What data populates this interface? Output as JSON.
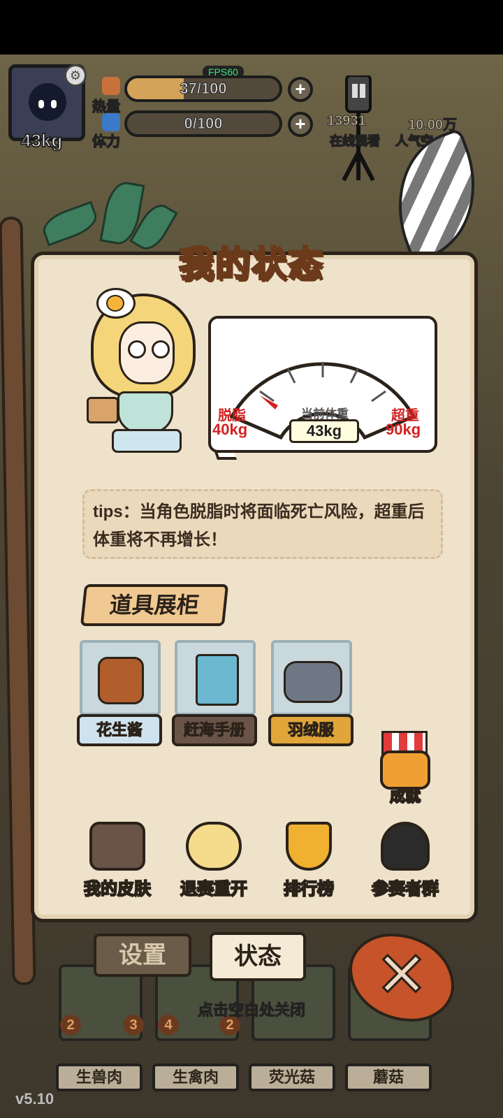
{
  "hud": {
    "weight": "43kg",
    "fps": "FPS60",
    "heat_label": "热量",
    "heat_value": "37/100",
    "heat_progress": 0.37,
    "stamina_label": "体力",
    "stamina_value": "0/100",
    "stamina_progress": 0,
    "viewers": "13931",
    "viewers_label": "在线观看",
    "popularity": "10.00万",
    "popularity_label": "人气空"
  },
  "panel": {
    "title": "我的状态",
    "gauge": {
      "min_label": "脱脂",
      "min_value": "40kg",
      "max_label": "超重",
      "max_value": "90kg",
      "current_label": "当前体重",
      "current_value": "43kg"
    },
    "tips": "tips：当角色脱脂时将面临死亡风险，超重后体重将不再增长！",
    "showcase_title": "道具展柜",
    "items": [
      {
        "label": "花生酱",
        "color": "#cfe3ee"
      },
      {
        "label": "赶海手册",
        "color": "#6a5448"
      },
      {
        "label": "羽绒服",
        "color": "#e0a63a"
      }
    ],
    "achievement_label": "成就",
    "actions": [
      {
        "label": "我的皮肤",
        "icon": "shirt-icon"
      },
      {
        "label": "退赛重开",
        "icon": "character-icon"
      },
      {
        "label": "排行榜",
        "icon": "trophy-icon"
      },
      {
        "label": "参赛者群",
        "icon": "penguin-icon"
      }
    ]
  },
  "tabs": {
    "settings": "设置",
    "status": "状态"
  },
  "close_hint": "点击空白处关闭",
  "background": {
    "counts": [
      "2",
      "3",
      "4",
      "2"
    ],
    "names": [
      "生兽肉",
      "生禽肉",
      "荧光菇",
      "蘑菇"
    ]
  },
  "version": "v5.10"
}
